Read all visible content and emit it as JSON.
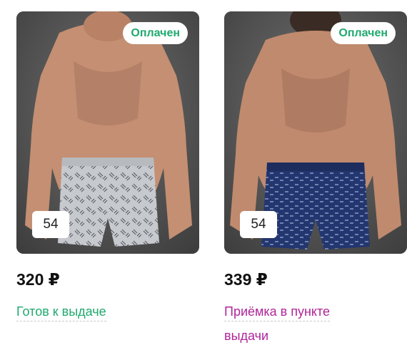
{
  "orders": [
    {
      "badge": "Оплачен",
      "size": "54",
      "price": "320 ₽",
      "status": "Готов к выдаче",
      "status_color": "#1fa96e",
      "shorts_color": "#c9ccd0",
      "image": "man-in-grey-patterned-boxer-shorts"
    },
    {
      "badge": "Оплачен",
      "size": "54",
      "price": "339 ₽",
      "status": "Приёмка в пункте выдачи",
      "status_color": "#b0259a",
      "shorts_color": "#23366f",
      "image": "man-in-navy-patterned-boxer-shorts"
    }
  ],
  "colors": {
    "paid_badge": "#1fa96e",
    "ready": "#1fa96e",
    "receiving": "#b0259a"
  }
}
